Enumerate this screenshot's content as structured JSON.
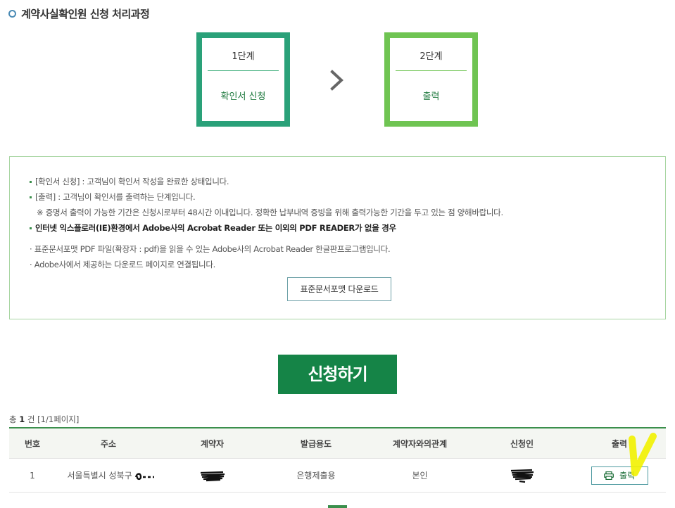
{
  "page": {
    "title": "계약사실확인원 신청 처리과정"
  },
  "steps": [
    {
      "num": "1단계",
      "name": "확인서 신청",
      "color": "#2aa179"
    },
    {
      "num": "2단계",
      "name": "출력",
      "color": "#6fc452"
    }
  ],
  "info": {
    "line1": "[확인서 신청] : 고객님이 확인서 작성을 완료한 상태입니다.",
    "line2": "[출력] : 고객님이 확인서를 출력하는 단계입니다.",
    "line3": "※ 증명서 출력이 가능한 기간은 신청시로부터 48시간 이내입니다. 정확한 납부내역 증빙을 위해 출력가능한 기간을 두고 있는 점 양해바랍니다.",
    "line4": "인터넷 익스플로러(IE)환경에서 Adobe사의 Acrobat Reader 또는 이외의 PDF READER가 없을 경우",
    "line5": "· 표준문서포맷 PDF 파일(확장자 : pdf)을 읽을 수 있는 Adobe사의 Acrobat Reader 한글판프로그램입니다.",
    "line6": "· Adobe사에서 제공하는 다운로드 페이지로 연결됩니다.",
    "download_label": "표준문서포맷 다운로드"
  },
  "apply_label": "신청하기",
  "list": {
    "count_prefix": "총",
    "count": "1",
    "count_suffix": "건 [1/1페이지]",
    "columns": [
      "번호",
      "주소",
      "계약자",
      "발급용도",
      "계약자와의관계",
      "신청인",
      "출력"
    ],
    "rows": [
      {
        "no": "1",
        "address": "서울특별시 성북구",
        "contractor": "",
        "purpose": "은행제출용",
        "relation": "본인",
        "applicant": "",
        "print_label": "출력"
      }
    ]
  },
  "colors": {
    "brand_green": "#158447",
    "step1": "#2aa179",
    "step2": "#6fc452",
    "highlight": "#f2f200"
  },
  "icons": [
    "circle-bullet-icon",
    "chevron-right-icon",
    "printer-icon",
    "checkmark-icon"
  ]
}
